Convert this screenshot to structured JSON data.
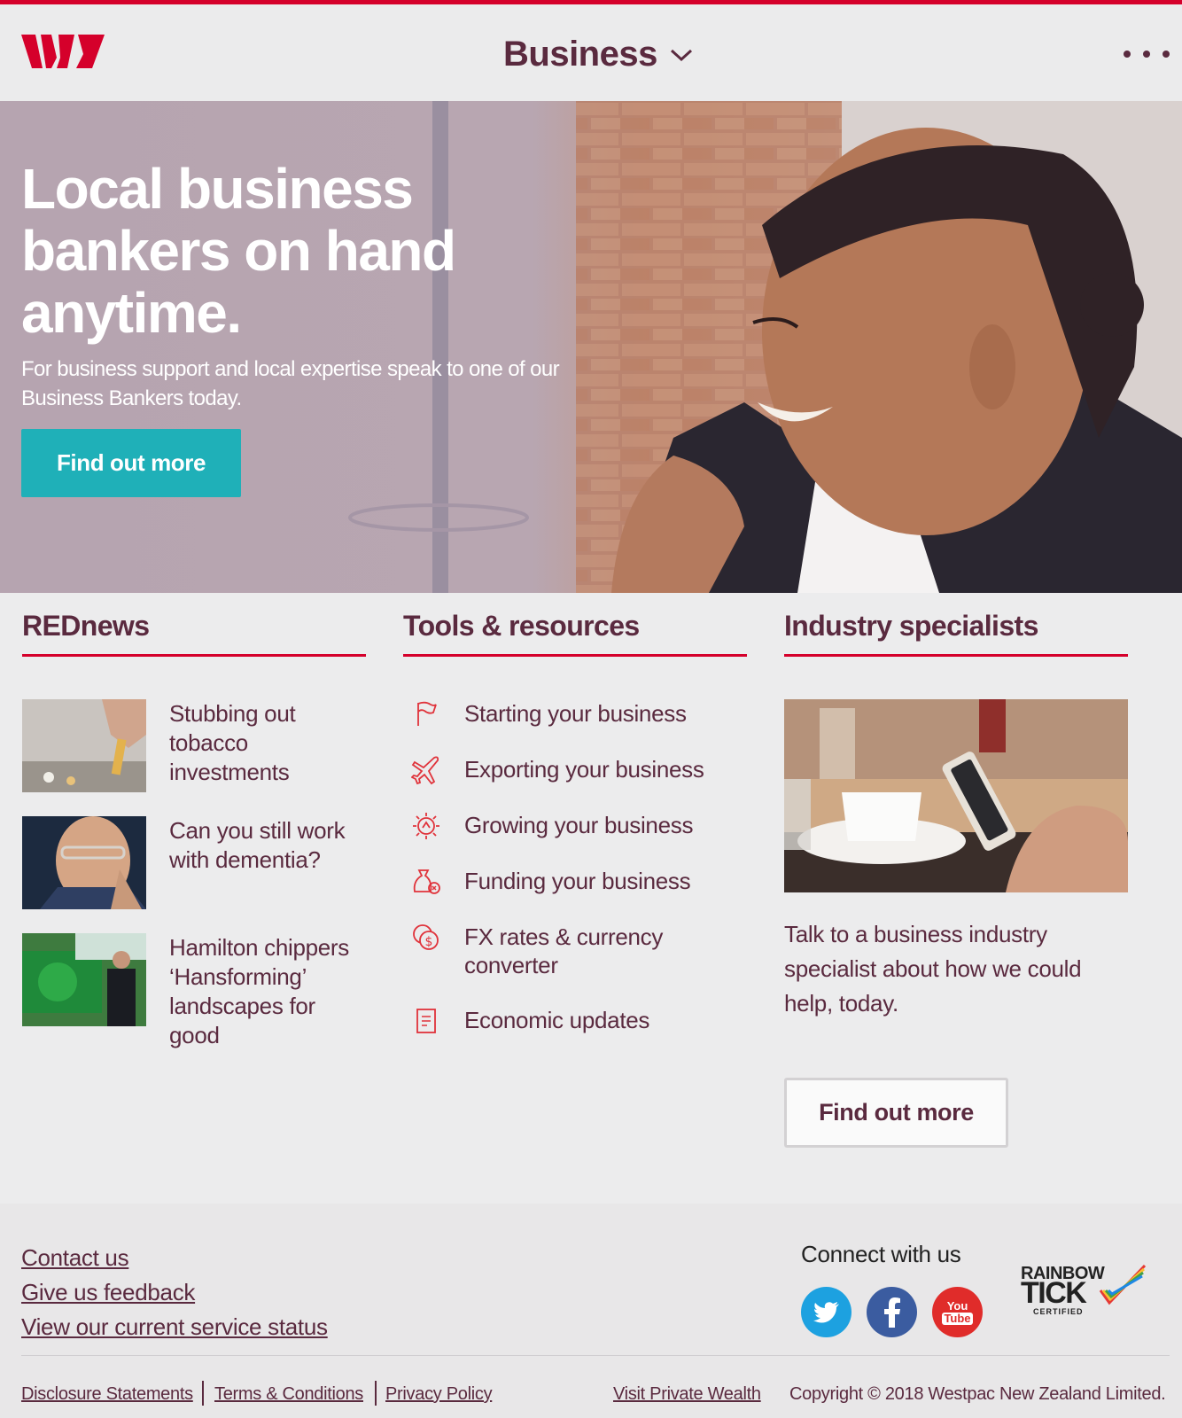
{
  "header": {
    "title": "Business",
    "brand_color": "#d5002b"
  },
  "hero": {
    "title": "Local business bankers on hand anytime.",
    "subtitle": "For business support and local expertise speak to one of our Business Bankers today.",
    "button": "Find out more",
    "button_color": "#1fb0b8"
  },
  "rednews": {
    "heading": "REDnews",
    "items": [
      {
        "label": "Stubbing out tobacco investments"
      },
      {
        "label": "Can you still work with dementia?"
      },
      {
        "label": "Hamilton chippers ‘Hansforming’ landscapes for good"
      }
    ]
  },
  "tools": {
    "heading": "Tools & resources",
    "items": [
      {
        "label": "Starting your business",
        "icon": "flag-icon"
      },
      {
        "label": "Exporting your business",
        "icon": "plane-icon"
      },
      {
        "label": "Growing your business",
        "icon": "growth-icon"
      },
      {
        "label": "Funding your business",
        "icon": "money-bag-icon"
      },
      {
        "label": "FX rates & currency converter",
        "icon": "currency-icon"
      },
      {
        "label": "Economic updates",
        "icon": "document-icon"
      }
    ]
  },
  "industry": {
    "heading": "Industry specialists",
    "text": "Talk to a business industry specialist about how we could help, today.",
    "button": "Find out more"
  },
  "footer": {
    "links": [
      "Contact us",
      "Give us feedback",
      "View our current service status"
    ],
    "connect": "Connect with us",
    "social": [
      "twitter",
      "facebook",
      "youtube"
    ],
    "youtube_text": [
      "You",
      "Tube"
    ],
    "rainbow_tick": [
      "RAINBOW",
      "TICK",
      "CERTIFIED"
    ],
    "legal": {
      "disclosure": "Disclosure Statements",
      "terms": "Terms & Conditions",
      "privacy": "Privacy Policy",
      "private_wealth": "Visit Private Wealth",
      "copyright": "Copyright © 2018 Westpac New Zealand Limited."
    }
  }
}
